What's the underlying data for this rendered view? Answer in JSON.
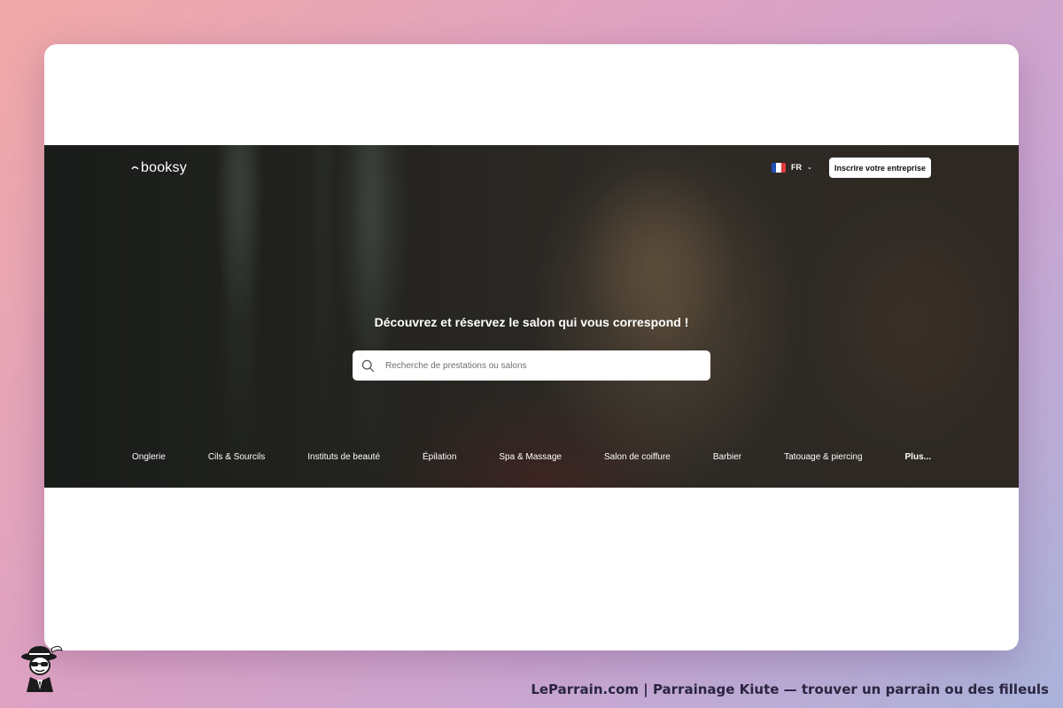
{
  "header": {
    "logo_text": "booksy",
    "language": {
      "code": "FR",
      "flag": "france-flag-icon"
    },
    "cta_label": "Inscrire votre entreprise"
  },
  "hero": {
    "headline": "Découvrez et réservez le salon qui vous correspond !",
    "search": {
      "placeholder": "Recherche de prestations ou salons",
      "value": "",
      "icon": "search-icon"
    }
  },
  "categories": [
    "Onglerie",
    "Cils & Sourcils",
    "Instituts de beauté",
    "Épilation",
    "Spa & Massage",
    "Salon de coiffure",
    "Barbier",
    "Tatouage & piercing",
    "Plus..."
  ],
  "footer": {
    "caption": "LeParrain.com | Parrainage Kiute — trouver un parrain ou des filleuls",
    "mascot_icon": "spy-mascot-icon"
  },
  "colors": {
    "hero_overlay": "#2b2b27",
    "button_bg": "#ffffff",
    "text_on_hero": "#ffffff",
    "flag_blue": "#1f4fb3",
    "flag_white": "#ffffff",
    "flag_red": "#e23a3a"
  }
}
